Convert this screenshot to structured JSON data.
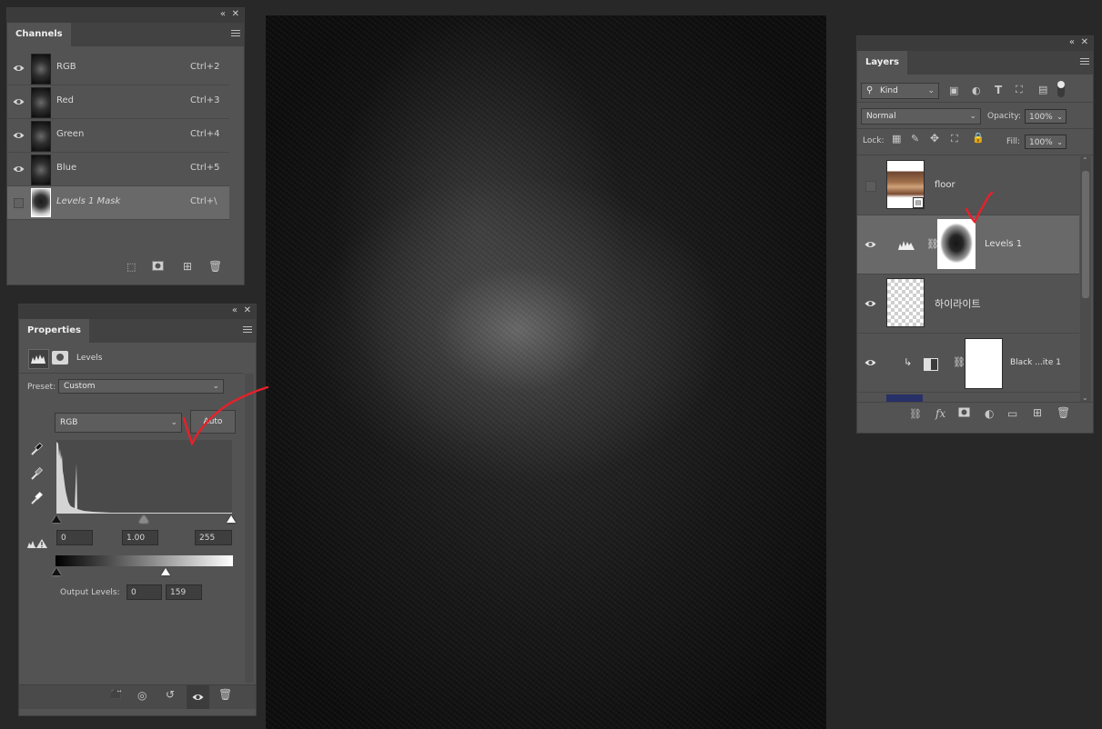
{
  "channels_panel": {
    "tab": "Channels",
    "rows": [
      {
        "name": "RGB",
        "shortcut": "Ctrl+2"
      },
      {
        "name": "Red",
        "shortcut": "Ctrl+3"
      },
      {
        "name": "Green",
        "shortcut": "Ctrl+4"
      },
      {
        "name": "Blue",
        "shortcut": "Ctrl+5"
      },
      {
        "name": "Levels 1 Mask",
        "shortcut": "Ctrl+\\"
      }
    ]
  },
  "properties_panel": {
    "tab": "Properties",
    "adjustment_title": "Levels",
    "preset_label": "Preset:",
    "preset_value": "Custom",
    "channel_value": "RGB",
    "auto_label": "Auto",
    "input_black": "0",
    "input_gamma": "1.00",
    "input_white": "255",
    "output_label": "Output Levels:",
    "output_black": "0",
    "output_white": "159"
  },
  "layers_panel": {
    "tab": "Layers",
    "filter_kind": "Kind",
    "blend_mode": "Normal",
    "opacity_label": "Opacity:",
    "opacity_value": "100%",
    "lock_label": "Lock:",
    "fill_label": "Fill:",
    "fill_value": "100%",
    "layers": [
      {
        "name": "floor",
        "visible": false
      },
      {
        "name": "Levels 1",
        "visible": true,
        "selected": true
      },
      {
        "name": "하이라이트",
        "visible": true
      },
      {
        "name": "Black ...ite 1",
        "visible": true
      }
    ]
  },
  "colors": {
    "annotation_red": "#e8202a",
    "panel_bg": "#535353",
    "selected_row": "#696969"
  }
}
